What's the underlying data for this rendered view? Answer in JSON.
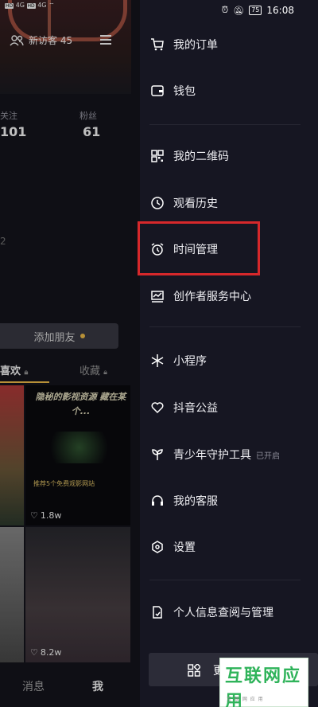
{
  "status_bar": {
    "left_hd1": "HD",
    "left_hd2": "HD",
    "left_net1": "4G",
    "left_net2": "4G",
    "battery": "75",
    "time": "16:08"
  },
  "profile": {
    "visitor_label": "新访客 45",
    "following_label": "关注",
    "following_count": "101",
    "followers_label": "粉丝",
    "followers_count": "61",
    "stray_digit": "2",
    "add_friend_label": "添加朋友",
    "tabs": {
      "likes": "喜欢",
      "favorites": "收藏"
    },
    "video_title": "隐秘的影视资源 藏在某个...",
    "video_subtitle": "推荐5个免费观影网站",
    "videos": [
      {
        "likes": "1.8w"
      },
      {
        "likes": "8.2w"
      }
    ]
  },
  "bottom_nav": {
    "messages": "消息",
    "me": "我"
  },
  "drawer": {
    "items": [
      {
        "label": "我的订单",
        "icon": "cart-icon"
      },
      {
        "label": "钱包",
        "icon": "wallet-icon"
      },
      {
        "label": "我的二维码",
        "icon": "qrcode-icon"
      },
      {
        "label": "观看历史",
        "icon": "clock-icon"
      },
      {
        "label": "时间管理",
        "icon": "alarm-icon"
      },
      {
        "label": "创作者服务中心",
        "icon": "chart-icon"
      },
      {
        "label": "小程序",
        "icon": "asterisk-icon"
      },
      {
        "label": "抖音公益",
        "icon": "heart-icon"
      },
      {
        "label": "青少年守护工具",
        "icon": "sprout-icon",
        "badge": "已开启"
      },
      {
        "label": "我的客服",
        "icon": "headset-icon"
      },
      {
        "label": "设置",
        "icon": "hexagon-icon"
      },
      {
        "label": "个人信息查阅与管理",
        "icon": "doc-icon"
      }
    ],
    "more_label": "更",
    "highlight_color": "#d6282b"
  },
  "watermark": {
    "text": "互联网应用",
    "sub": "互 联 网 应 用"
  }
}
